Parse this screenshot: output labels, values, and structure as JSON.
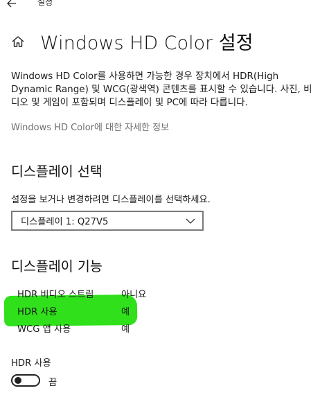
{
  "topbar": {
    "title": "설정",
    "back_icon": "arrow-left-icon"
  },
  "header": {
    "icon": "home-icon",
    "title": "Windows HD Color 설정"
  },
  "description": "Windows HD Color를 사용하면 가능한 경우 장치에서 HDR(High Dynamic Range) 및 WCG(광색역) 콘텐츠를 표시할 수 있습니다. 사진, 비디오 및 게임이 포함되며 디스플레이 및 PC에 따라 다릅니다.",
  "more_link": "Windows HD Color에 대한 자세한 정보",
  "display_select": {
    "title": "디스플레이 선택",
    "label": "설정을 보거나 변경하려면 디스플레이를 선택하세요.",
    "selected": "디스플레이 1: Q27V5"
  },
  "capabilities": {
    "title": "디스플레이 기능",
    "rows": [
      {
        "label": "HDR 비디오 스트림",
        "value": "아니요"
      },
      {
        "label": "HDR 사용",
        "value": "예"
      },
      {
        "label": "WCG 앱 사용",
        "value": "예"
      }
    ]
  },
  "hdr_toggle": {
    "label": "HDR 사용",
    "state": "끔",
    "on": false
  },
  "colors": {
    "highlight": "#2fe01a",
    "link": "#6f6f6f"
  }
}
